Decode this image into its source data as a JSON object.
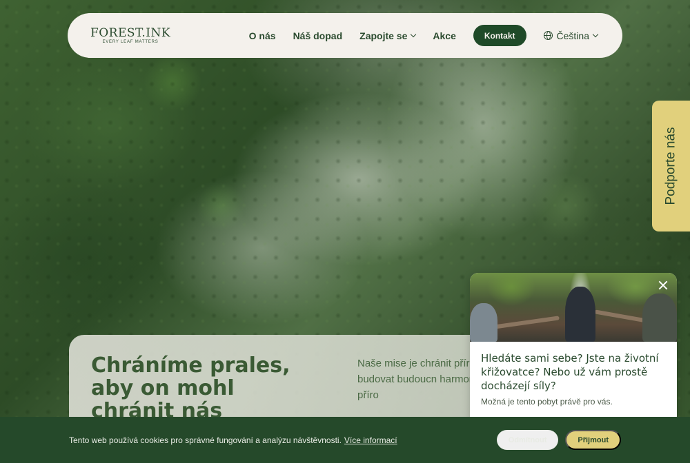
{
  "header": {
    "logo_main": "FOREST.INK",
    "logo_sub": "EVERY LEAF MATTERS",
    "nav": [
      {
        "label": "O nás"
      },
      {
        "label": "Náš dopad"
      },
      {
        "label": "Zapojte se"
      },
      {
        "label": "Akce"
      }
    ],
    "contact_label": "Kontakt",
    "language": "Čeština"
  },
  "side_tab": {
    "label": "Podporte nás"
  },
  "hero": {
    "title": "Chráníme prales, aby on mohl chránit nás",
    "description": "Naše mise je chránit přír růst a budovat budoucn harmonii člověka s příro"
  },
  "popup": {
    "title": "Hledáte sami sebe? Jste na životní křižovatce? Nebo už vám prostě docházejí síly?",
    "text": "Možná je tento pobyt právě pro vás."
  },
  "cookie": {
    "text": "Tento web používá cookies pro správné fungování a analýzu návštěvnosti.",
    "link": "Více informací",
    "decline": "Odmítnout",
    "accept": "Přijmout"
  },
  "colors": {
    "brand_green": "#1f4a28",
    "accent_yellow": "#e1d07c",
    "header_bg": "#f4f1ec"
  }
}
